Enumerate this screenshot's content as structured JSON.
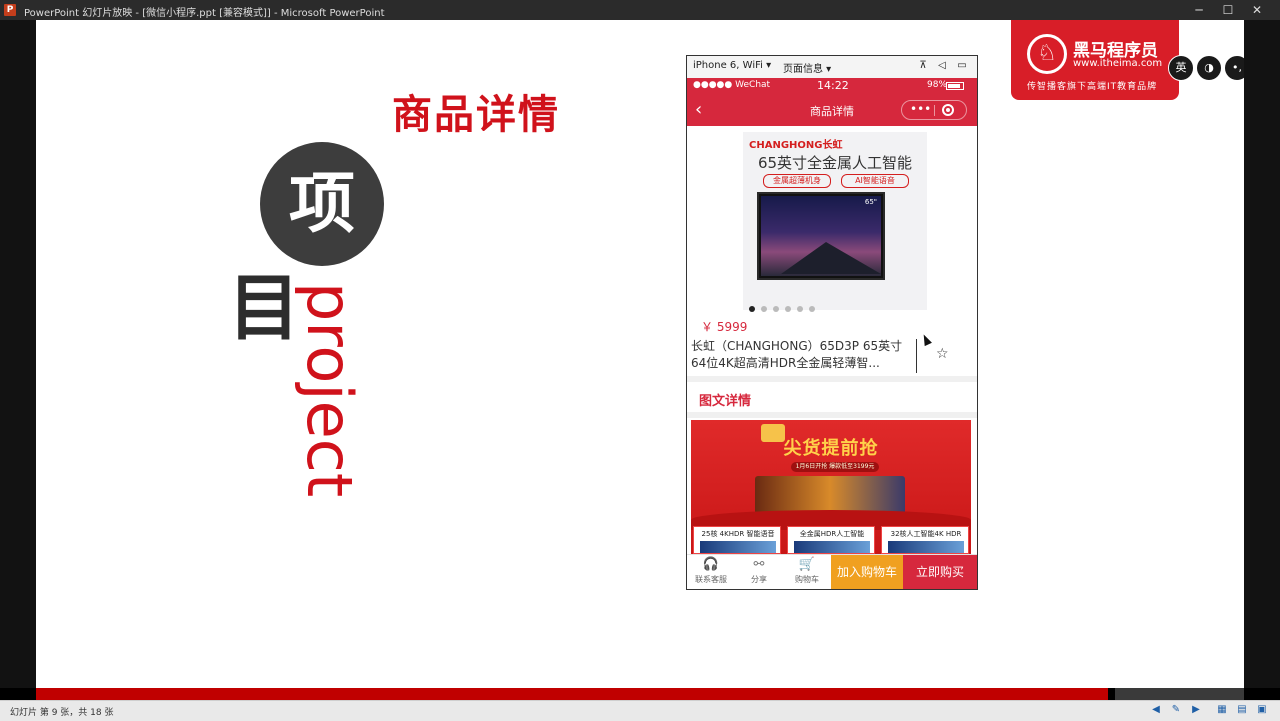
{
  "window": {
    "title": "PowerPoint 幻灯片放映 - [微信小程序.ppt [兼容模式]] - Microsoft PowerPoint",
    "app_icon": "P",
    "minimize": "─",
    "maximize": "☐",
    "close": "✕"
  },
  "slide": {
    "heading": "商品详情",
    "circle_char": "项",
    "second_char": "目",
    "vertical_word": "project"
  },
  "logo": {
    "glyph": "♘",
    "name": "黑马程序员",
    "url": "www.itheima.com",
    "slogan": "传智播客旗下高端IT教育品牌"
  },
  "ime": [
    "英",
    "◑",
    "•,",
    "⊙"
  ],
  "phone": {
    "devtools": {
      "device": "iPhone 6, WiFi ▾",
      "page_info": "页面信息 ▾",
      "icons": [
        "⊼",
        "◁",
        "▭"
      ]
    },
    "statusbar": {
      "carrier": "●●●●● WeChat",
      "time": "14:22",
      "battery": "98%"
    },
    "navbar": {
      "back": "‹",
      "title": "商品详情",
      "more": "•••"
    },
    "banner": {
      "brand": "CHANGHONG长虹",
      "title": "65英寸全金属人工智能",
      "tag1": "金属超薄机身",
      "tag2": "AI智能语音",
      "screen_badge": "65\"",
      "slides": 6,
      "active_slide": 1
    },
    "product": {
      "price": "￥ 5999",
      "name": "长虹（CHANGHONG）65D3P 65英寸64位4K超高清HDR全金属轻薄智...",
      "fav_icon": "☆"
    },
    "section_title": "图文详情",
    "promo": {
      "title": "尖货提前抢",
      "subtitle": "1月6日开抢 爆款低至3199元",
      "cards": [
        "25核 4KHDR 智能语音",
        "全金属HDR人工智能",
        "32核人工智能4K HDR"
      ]
    },
    "bottom": {
      "service": "联系客服",
      "service_icon": "🎧",
      "share": "分享",
      "share_icon": "⚯",
      "cart": "购物车",
      "cart_icon": "🛒",
      "add_cart": "加入购物车",
      "buy_now": "立即购买"
    }
  },
  "statusbar": {
    "text": "幻灯片 第 9 张，共 18 张"
  },
  "colors": {
    "brand_red": "#d0121b",
    "wechat_red": "#d6283d",
    "cart_orange": "#f0a020"
  }
}
